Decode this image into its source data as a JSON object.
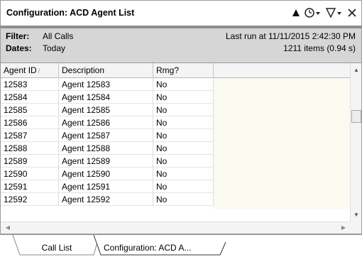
{
  "window": {
    "title": "Configuration: ACD Agent List",
    "tools": [
      {
        "icon": "up-triangle-icon"
      },
      {
        "icon": "clock-dropdown-icon"
      },
      {
        "icon": "filter-dropdown-icon"
      },
      {
        "icon": "close-icon"
      }
    ]
  },
  "info": {
    "filter_key": "Filter:",
    "filter_value": "All Calls",
    "dates_key": "Dates:",
    "dates_value": "Today",
    "last_run": "Last run at 11/11/2015 2:42:30 PM",
    "items": "1211 items (0.94 s)"
  },
  "grid": {
    "columns": [
      "Agent ID",
      "Description",
      "Rmg?"
    ],
    "sort_indicator": "/",
    "rows": [
      [
        "12583",
        "Agent 12583",
        "No"
      ],
      [
        "12584",
        "Agent 12584",
        "No"
      ],
      [
        "12585",
        "Agent 12585",
        "No"
      ],
      [
        "12586",
        "Agent 12586",
        "No"
      ],
      [
        "12587",
        "Agent 12587",
        "No"
      ],
      [
        "12588",
        "Agent 12588",
        "No"
      ],
      [
        "12589",
        "Agent 12589",
        "No"
      ],
      [
        "12590",
        "Agent 12590",
        "No"
      ],
      [
        "12591",
        "Agent 12591",
        "No"
      ],
      [
        "12592",
        "Agent 12592",
        "No"
      ]
    ]
  },
  "tabs": [
    {
      "label": "Call List",
      "active": false
    },
    {
      "label": "Configuration: ACD A...",
      "active": true
    }
  ],
  "colors": {
    "infobar_bg": "#d6d6d6",
    "empty_area_bg": "#fafaf0",
    "border": "#9a9a9a"
  }
}
